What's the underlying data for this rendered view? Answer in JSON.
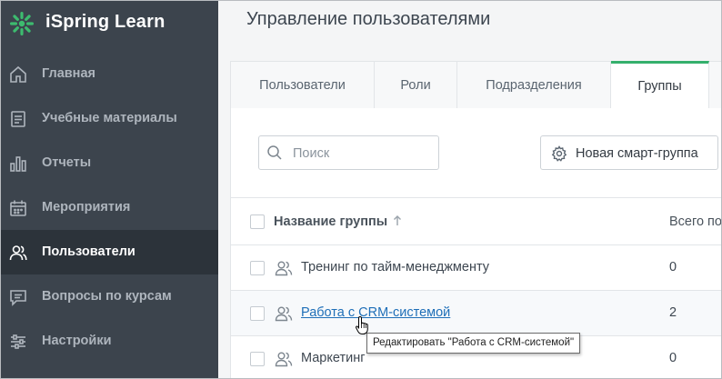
{
  "brand": {
    "name": "iSpring Learn",
    "logo": "ispring-logo",
    "accent": "#3dbb6f"
  },
  "sidebar": {
    "items": [
      {
        "label": "Главная",
        "icon": "home-icon",
        "active": false
      },
      {
        "label": "Учебные материалы",
        "icon": "book-icon",
        "active": false
      },
      {
        "label": "Отчеты",
        "icon": "bar-chart-icon",
        "active": false
      },
      {
        "label": "Мероприятия",
        "icon": "calendar-icon",
        "active": false
      },
      {
        "label": "Пользователи",
        "icon": "users-icon",
        "active": true
      },
      {
        "label": "Вопросы по курсам",
        "icon": "chat-icon",
        "active": false
      },
      {
        "label": "Настройки",
        "icon": "sliders-icon",
        "active": false
      }
    ]
  },
  "page": {
    "title": "Управление пользователями"
  },
  "tabs": [
    {
      "label": "Пользователи",
      "active": false
    },
    {
      "label": "Роли",
      "active": false
    },
    {
      "label": "Подразделения",
      "active": false
    },
    {
      "label": "Группы",
      "active": true
    }
  ],
  "search": {
    "placeholder": "Поиск",
    "icon": "search-icon"
  },
  "toolbar": {
    "smart_group_label": "Новая смарт-группа",
    "smart_group_icon": "gear-icon"
  },
  "table": {
    "columns": {
      "name": "Название группы",
      "total": "Всего по"
    },
    "rows": [
      {
        "name": "Тренинг по тайм-менеджменту",
        "count": "0",
        "link": false
      },
      {
        "name": "Работа с CRM-системой",
        "count": "2",
        "link": true
      },
      {
        "name": "Маркетинг",
        "count": "0",
        "link": false
      }
    ]
  },
  "tooltip": {
    "text": "Редактировать \"Работа с CRM-системой\""
  },
  "colors": {
    "sidebar_bg": "#3c444d",
    "sidebar_active": "#2c333a",
    "tab_accent": "#35b06c",
    "link": "#1f6fb8"
  }
}
